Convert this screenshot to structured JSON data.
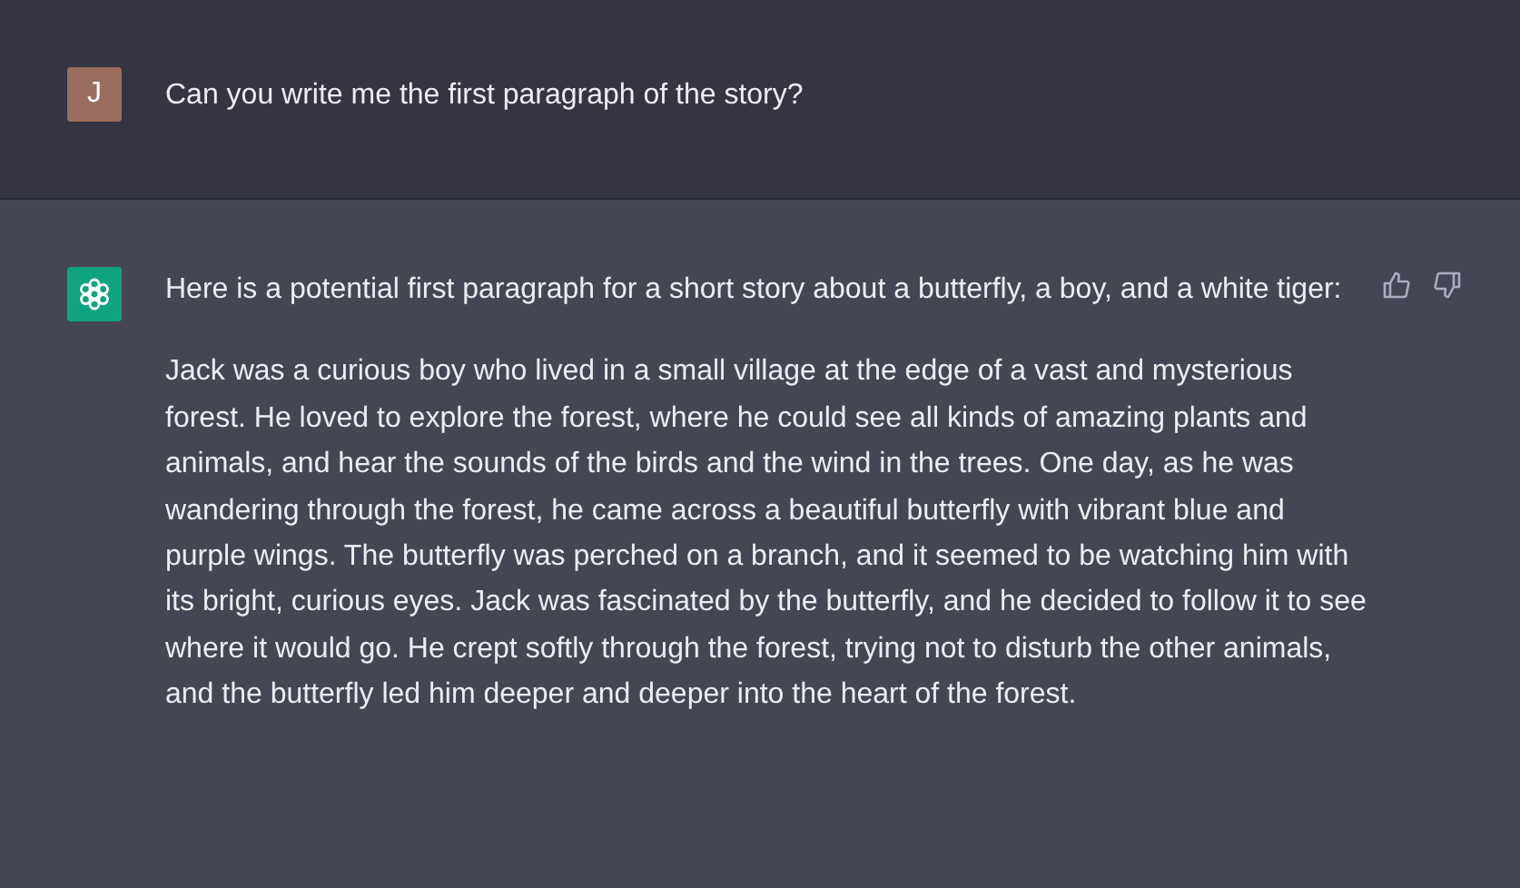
{
  "messages": [
    {
      "kind": "user",
      "avatar_initial": "J",
      "paragraphs": [
        "Can you write me the first paragraph of the story?"
      ]
    },
    {
      "kind": "assistant",
      "paragraphs": [
        "Here is a potential first paragraph for a short story about a butterfly, a boy, and a white tiger:",
        "Jack was a curious boy who lived in a small village at the edge of a vast and mysterious forest. He loved to explore the forest, where he could see all kinds of amazing plants and animals, and hear the sounds of the birds and the wind in the trees. One day, as he was wandering through the forest, he came across a beautiful butterfly with vibrant blue and purple wings. The butterfly was perched on a branch, and it seemed to be watching him with its bright, curious eyes. Jack was fascinated by the butterfly, and he decided to follow it to see where it would go. He crept softly through the forest, trying not to disturb the other animals, and the butterfly led him deeper and deeper into the heart of the forest."
      ]
    }
  ]
}
